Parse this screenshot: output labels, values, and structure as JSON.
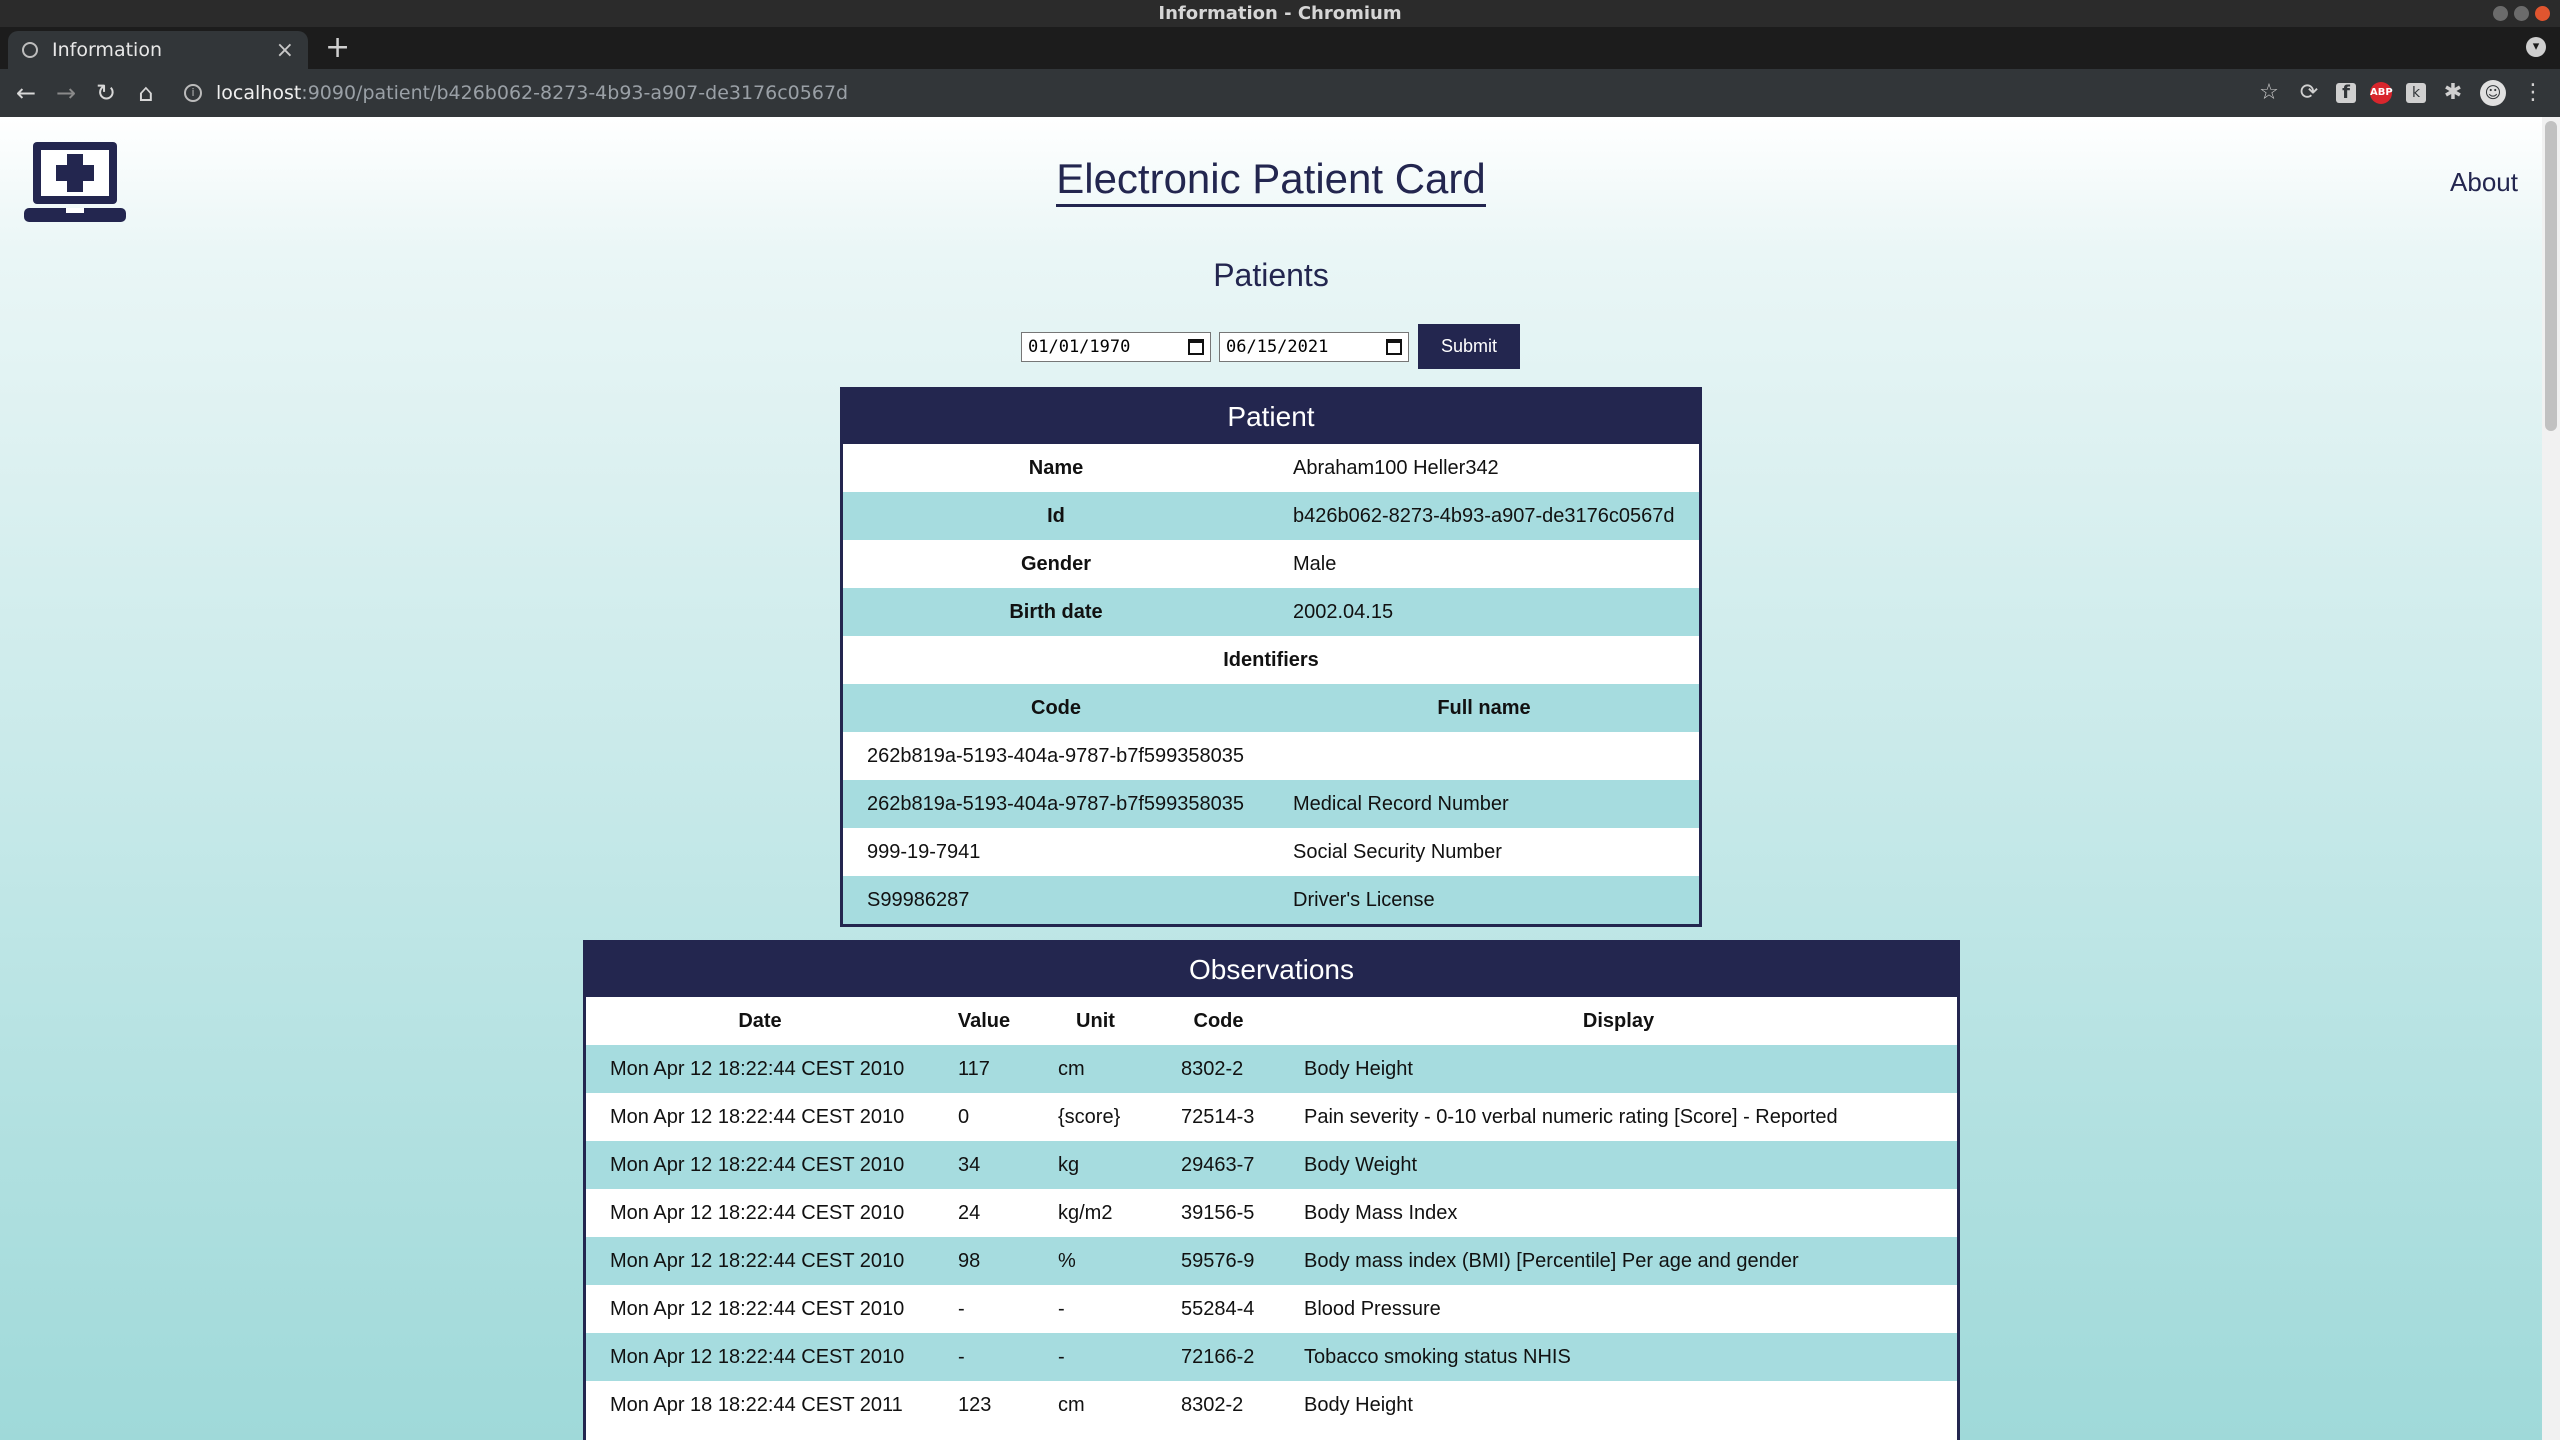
{
  "window": {
    "title": "Information - Chromium"
  },
  "tab": {
    "title": "Information",
    "close": "×",
    "new_tab": "+"
  },
  "toolbar": {
    "url_host": "localhost",
    "url_path": ":9090/patient/b426b062-8273-4b93-a907-de3176c0567d"
  },
  "extensions": {
    "fb": "f",
    "abp": "ABP",
    "k": "k"
  },
  "page": {
    "site_title": "Electronic Patient Card",
    "about": "About",
    "heading": "Patients"
  },
  "filter": {
    "from_date": "01/01/1970",
    "to_date": "06/15/2021",
    "submit": "Submit"
  },
  "patient": {
    "header": "Patient",
    "name_label": "Name",
    "name": "Abraham100 Heller342",
    "id_label": "Id",
    "id": "b426b062-8273-4b93-a907-de3176c0567d",
    "gender_label": "Gender",
    "gender": "Male",
    "birth_label": "Birth date",
    "birth_date": "2002.04.15",
    "identifiers_label": "Identifiers",
    "code_col": "Code",
    "fullname_col": "Full name",
    "identifiers": [
      {
        "code": "262b819a-5193-404a-9787-b7f599358035",
        "name": ""
      },
      {
        "code": "262b819a-5193-404a-9787-b7f599358035",
        "name": "Medical Record Number"
      },
      {
        "code": "999-19-7941",
        "name": "Social Security Number"
      },
      {
        "code": "S99986287",
        "name": "Driver's License"
      }
    ]
  },
  "observations": {
    "header": "Observations",
    "columns": {
      "date": "Date",
      "value": "Value",
      "unit": "Unit",
      "code": "Code",
      "display": "Display"
    },
    "rows": [
      {
        "date": "Mon Apr 12 18:22:44 CEST 2010",
        "value": "117",
        "unit": "cm",
        "code": "8302-2",
        "display": "Body Height"
      },
      {
        "date": "Mon Apr 12 18:22:44 CEST 2010",
        "value": "0",
        "unit": "{score}",
        "code": "72514-3",
        "display": "Pain severity - 0-10 verbal numeric rating [Score] - Reported"
      },
      {
        "date": "Mon Apr 12 18:22:44 CEST 2010",
        "value": "34",
        "unit": "kg",
        "code": "29463-7",
        "display": "Body Weight"
      },
      {
        "date": "Mon Apr 12 18:22:44 CEST 2010",
        "value": "24",
        "unit": "kg/m2",
        "code": "39156-5",
        "display": "Body Mass Index"
      },
      {
        "date": "Mon Apr 12 18:22:44 CEST 2010",
        "value": "98",
        "unit": "%",
        "code": "59576-9",
        "display": "Body mass index (BMI) [Percentile] Per age and gender"
      },
      {
        "date": "Mon Apr 12 18:22:44 CEST 2010",
        "value": "-",
        "unit": "-",
        "code": "55284-4",
        "display": "Blood Pressure"
      },
      {
        "date": "Mon Apr 12 18:22:44 CEST 2010",
        "value": "-",
        "unit": "-",
        "code": "72166-2",
        "display": "Tobacco smoking status NHIS"
      },
      {
        "date": "Mon Apr 18 18:22:44 CEST 2011",
        "value": "123",
        "unit": "cm",
        "code": "8302-2",
        "display": "Body Height"
      }
    ]
  }
}
